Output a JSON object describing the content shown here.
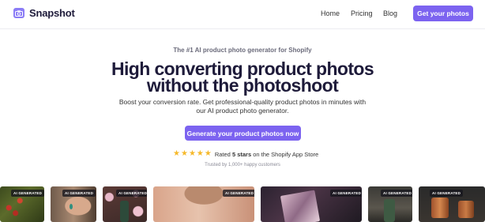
{
  "brand": {
    "name": "Snapshot",
    "logo_icon": "camera-icon",
    "accent": "#8b7cf6"
  },
  "nav": {
    "links": [
      "Home",
      "Pricing",
      "Blog"
    ],
    "cta": "Get your photos"
  },
  "hero": {
    "eyebrow": "The #1 AI product photo generator for Shopify",
    "headline_line1": "High converting product photos",
    "headline_line2": "without the photoshoot",
    "sub_line1": "Boost your conversion rate. Get professional-quality product photos in minutes with",
    "sub_line2": "our AI product photo generator.",
    "cta": "Generate your product photos now"
  },
  "rating": {
    "stars": 5,
    "prefix": "Rated",
    "highlight": "5 stars",
    "suffix": "on the Shopify App Store",
    "star_color": "#f6b92b"
  },
  "trusted": "Trusted by 1,000+ happy customers",
  "gallery": {
    "badge": "AI GENERATED",
    "items": [
      {
        "subject": "berries-on-leaves"
      },
      {
        "subject": "woman-earring"
      },
      {
        "subject": "green-bottle-flowers"
      },
      {
        "subject": "woman-necklace"
      },
      {
        "subject": "marble-notebook"
      },
      {
        "subject": "green-bottle-stand"
      },
      {
        "subject": "copper-mug"
      }
    ]
  },
  "colors": {
    "button": "#7c63f0",
    "text": "#1e1b3a"
  }
}
